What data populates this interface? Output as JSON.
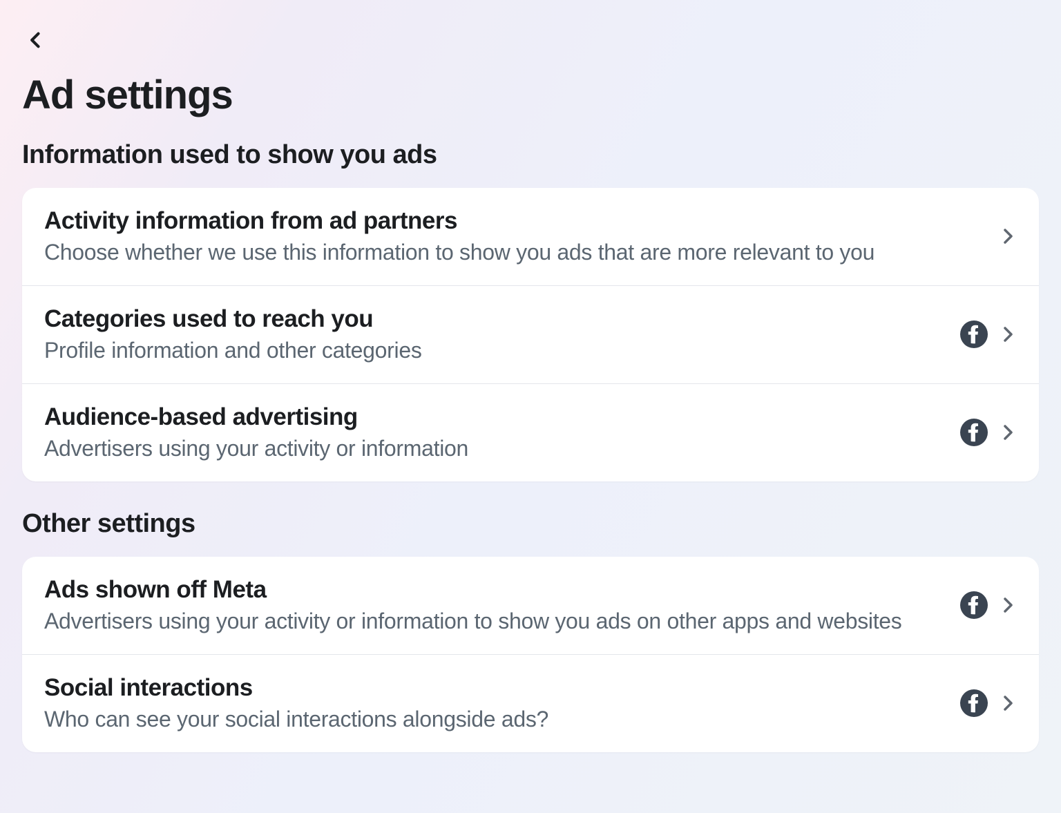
{
  "header": {
    "page_title": "Ad settings"
  },
  "sections": {
    "info_used": {
      "title": "Information used to show you ads",
      "items": [
        {
          "title": "Activity information from ad partners",
          "subtitle": "Choose whether we use this information to show you ads that are more relevant to you",
          "has_fb_icon": false
        },
        {
          "title": "Categories used to reach you",
          "subtitle": "Profile information and other categories",
          "has_fb_icon": true
        },
        {
          "title": "Audience-based advertising",
          "subtitle": "Advertisers using your activity or information",
          "has_fb_icon": true
        }
      ]
    },
    "other_settings": {
      "title": "Other settings",
      "items": [
        {
          "title": "Ads shown off Meta",
          "subtitle": "Advertisers using your activity or information to show you ads on other apps and websites",
          "has_fb_icon": true
        },
        {
          "title": "Social interactions",
          "subtitle": "Who can see your social interactions alongside ads?",
          "has_fb_icon": true
        }
      ]
    }
  }
}
